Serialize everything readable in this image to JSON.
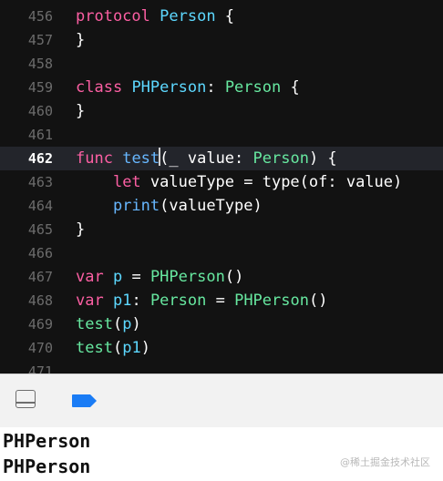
{
  "editor": {
    "lines": [
      {
        "num": "456",
        "tokens": [
          [
            "kw",
            "protocol"
          ],
          [
            "plain",
            " "
          ],
          [
            "type",
            "Person"
          ],
          [
            "plain",
            " {"
          ]
        ]
      },
      {
        "num": "457",
        "tokens": [
          [
            "plain",
            "}"
          ]
        ]
      },
      {
        "num": "458",
        "tokens": []
      },
      {
        "num": "459",
        "tokens": [
          [
            "kw",
            "class"
          ],
          [
            "plain",
            " "
          ],
          [
            "type",
            "PHPerson"
          ],
          [
            "plain",
            ": "
          ],
          [
            "usertype",
            "Person"
          ],
          [
            "plain",
            " {"
          ]
        ]
      },
      {
        "num": "460",
        "tokens": [
          [
            "plain",
            "}"
          ]
        ]
      },
      {
        "num": "461",
        "tokens": []
      },
      {
        "num": "462",
        "current": true,
        "caret_after": 1,
        "tokens": [
          [
            "kw",
            "func"
          ],
          [
            "plain",
            " "
          ],
          [
            "func",
            "test"
          ],
          [
            "plain",
            "(_ value: "
          ],
          [
            "usertype",
            "Person"
          ],
          [
            "plain",
            ") {"
          ]
        ]
      },
      {
        "num": "463",
        "tokens": [
          [
            "plain",
            "    "
          ],
          [
            "kw",
            "let"
          ],
          [
            "plain",
            " valueType = type(of: value)"
          ]
        ]
      },
      {
        "num": "464",
        "tokens": [
          [
            "plain",
            "    "
          ],
          [
            "func",
            "print"
          ],
          [
            "plain",
            "(valueType)"
          ]
        ]
      },
      {
        "num": "465",
        "tokens": [
          [
            "plain",
            "}"
          ]
        ]
      },
      {
        "num": "466",
        "tokens": []
      },
      {
        "num": "467",
        "tokens": [
          [
            "kw",
            "var"
          ],
          [
            "plain",
            " "
          ],
          [
            "type",
            "p"
          ],
          [
            "plain",
            " = "
          ],
          [
            "call",
            "PHPerson"
          ],
          [
            "plain",
            "()"
          ]
        ]
      },
      {
        "num": "468",
        "tokens": [
          [
            "kw",
            "var"
          ],
          [
            "plain",
            " "
          ],
          [
            "type",
            "p1"
          ],
          [
            "plain",
            ": "
          ],
          [
            "usertype",
            "Person"
          ],
          [
            "plain",
            " = "
          ],
          [
            "call",
            "PHPerson"
          ],
          [
            "plain",
            "()"
          ]
        ]
      },
      {
        "num": "469",
        "tokens": [
          [
            "call",
            "test"
          ],
          [
            "plain",
            "("
          ],
          [
            "type",
            "p"
          ],
          [
            "plain",
            ")"
          ]
        ]
      },
      {
        "num": "470",
        "tokens": [
          [
            "call",
            "test"
          ],
          [
            "plain",
            "("
          ],
          [
            "type",
            "p1"
          ],
          [
            "plain",
            ")"
          ]
        ]
      },
      {
        "num": "471",
        "tokens": []
      }
    ]
  },
  "debug_bar": {
    "toggle_icon": "hide-debug-area-icon",
    "breakpoint_icon": "breakpoint-toggle-icon",
    "breakpoint_color": "#1a7cf5"
  },
  "console": {
    "output_lines": [
      "PHPerson",
      "PHPerson"
    ]
  },
  "watermark": "@稀土掘金技术社区"
}
